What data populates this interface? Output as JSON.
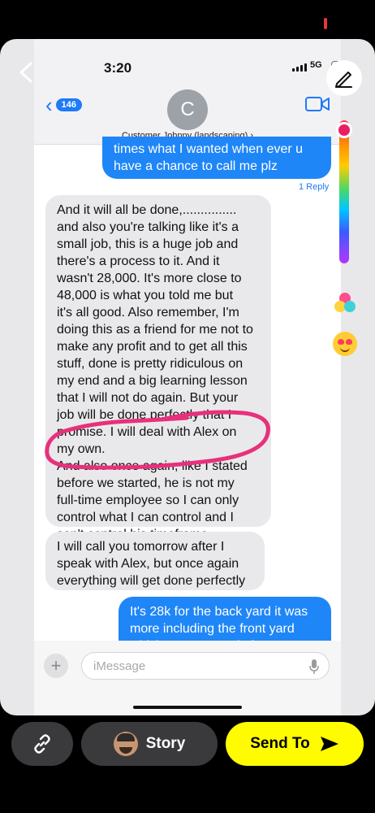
{
  "status_bar": {
    "time": "3:20",
    "network": "5G",
    "battery_color": "#e53935"
  },
  "header": {
    "back_count": "146",
    "contact_initial": "C",
    "contact_name": "Customer Johnny (landscaping)",
    "icons": [
      "chevron-left-icon",
      "video-camera-icon"
    ]
  },
  "messages": [
    {
      "direction": "outgoing",
      "text": "times what I wanted when ever u\nhave a chance to call me plz"
    },
    {
      "direction": "incoming",
      "text": "And it will all be done,...............\nand also you're talking like it's a\nsmall job, this is a huge job and\nthere's a process to it. And it\nwasn't 28,000. It's more close to\n48,000 is what you told me but\nit's all good. Also remember, I'm\ndoing this as a friend for me not to\nmake any profit and to get all this\nstuff, done is pretty ridiculous on\nmy end and a big learning lesson\nthat I will not do again. But your\njob will be done perfectly that I\npromise. I will deal with Alex on\nmy own.\nAnd also once again, like I stated\nbefore we started, he is not my\nfull-time employee so I can only\ncontrol what I can control and I\ncan't control his timeframe"
    },
    {
      "direction": "incoming",
      "text": "I will call you tomorrow after I\nspeak with Alex, but once again\neverything will get done perfectly"
    },
    {
      "direction": "outgoing",
      "text": "It's 28k for the back yard it was\nmore including the front yard\nwhich I wasn't ready for"
    }
  ],
  "reply_link": "1 Reply",
  "composer": {
    "placeholder": "iMessage"
  },
  "snap_tools": {
    "annotation_color": "#e8307c",
    "icons": [
      "close-chevron-icon",
      "pencil-icon",
      "color-slider",
      "color-palette-icon",
      "heart-eyes-emoji-icon"
    ]
  },
  "snap_bar": {
    "story_label": "Story",
    "send_label": "Send To",
    "send_color": "#fffc00"
  }
}
